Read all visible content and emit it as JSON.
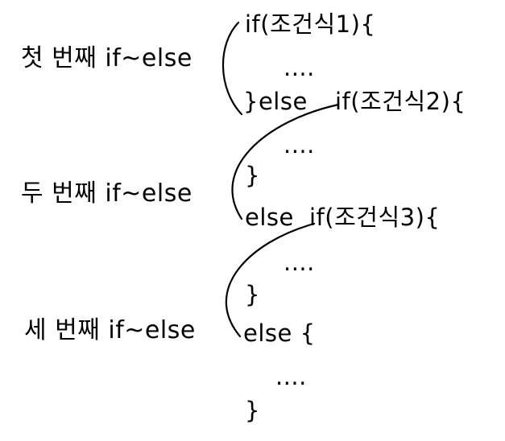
{
  "labels": {
    "first": "첫 번째 if~else",
    "second": "두 번째 if~else",
    "third": "세 번째 if~else"
  },
  "code": {
    "if_cond1": "if(조건식1){",
    "dots1": "....",
    "else_part1": "}else",
    "if_cond2": "if(조건식2){",
    "dots2": "....",
    "close2": "}",
    "else_part2": "else",
    "if_cond3": "if(조건식3){",
    "dots3": "....",
    "close3": "}",
    "else_part3": "else {",
    "dots4": "....",
    "close4": "}"
  }
}
